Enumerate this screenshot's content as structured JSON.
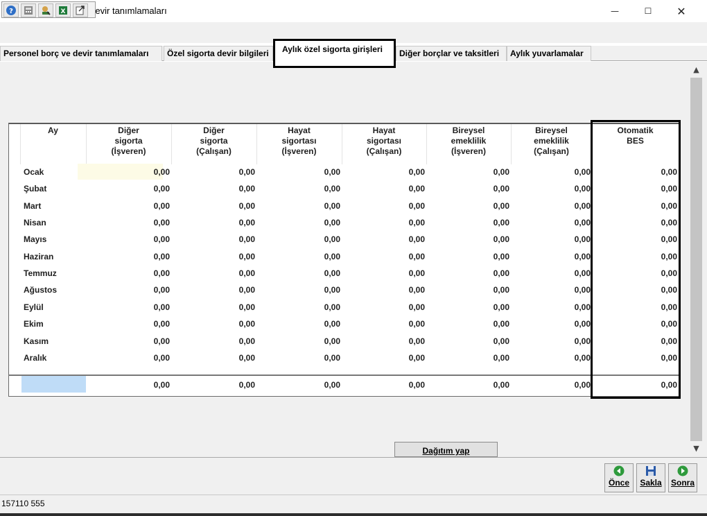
{
  "window": {
    "title": "Personel borç ve devir tanımlamaları",
    "controls": {
      "minimize": "—",
      "maximize": "☐",
      "close": "✕"
    }
  },
  "toolbar": {
    "icons": [
      "help-icon",
      "calculator-icon",
      "search-user-icon",
      "excel-icon",
      "export-icon"
    ]
  },
  "tabs": [
    {
      "label": "Personel borç ve devir tanımlamaları"
    },
    {
      "label": "Özel sigorta devir bilgileri"
    },
    {
      "label": "Aylık özel sigorta girişleri",
      "active": true
    },
    {
      "label": "Diğer borçlar ve taksitleri"
    },
    {
      "label": "Aylık yuvarlamalar"
    }
  ],
  "grid": {
    "headers": [
      "Ay",
      "Diğer\nsigorta\n(İşveren)",
      "Diğer\nsigorta\n(Çalışan)",
      "Hayat\nsigortası\n(İşveren)",
      "Hayat\nsigortası\n(Çalışan)",
      "Bireysel\nemeklilik\n(İşveren)",
      "Bireysel\nemeklilik\n(Çalışan)",
      "Otomatik\nBES"
    ],
    "rows": [
      {
        "month": "Ocak",
        "values": [
          "0,00",
          "0,00",
          "0,00",
          "0,00",
          "0,00",
          "0,00",
          "0,00"
        ]
      },
      {
        "month": "Şubat",
        "values": [
          "0,00",
          "0,00",
          "0,00",
          "0,00",
          "0,00",
          "0,00",
          "0,00"
        ]
      },
      {
        "month": "Mart",
        "values": [
          "0,00",
          "0,00",
          "0,00",
          "0,00",
          "0,00",
          "0,00",
          "0,00"
        ]
      },
      {
        "month": "Nisan",
        "values": [
          "0,00",
          "0,00",
          "0,00",
          "0,00",
          "0,00",
          "0,00",
          "0,00"
        ]
      },
      {
        "month": "Mayıs",
        "values": [
          "0,00",
          "0,00",
          "0,00",
          "0,00",
          "0,00",
          "0,00",
          "0,00"
        ]
      },
      {
        "month": "Haziran",
        "values": [
          "0,00",
          "0,00",
          "0,00",
          "0,00",
          "0,00",
          "0,00",
          "0,00"
        ]
      },
      {
        "month": "Temmuz",
        "values": [
          "0,00",
          "0,00",
          "0,00",
          "0,00",
          "0,00",
          "0,00",
          "0,00"
        ]
      },
      {
        "month": "Ağustos",
        "values": [
          "0,00",
          "0,00",
          "0,00",
          "0,00",
          "0,00",
          "0,00",
          "0,00"
        ]
      },
      {
        "month": "Eylül",
        "values": [
          "0,00",
          "0,00",
          "0,00",
          "0,00",
          "0,00",
          "0,00",
          "0,00"
        ]
      },
      {
        "month": "Ekim",
        "values": [
          "0,00",
          "0,00",
          "0,00",
          "0,00",
          "0,00",
          "0,00",
          "0,00"
        ]
      },
      {
        "month": "Kasım",
        "values": [
          "0,00",
          "0,00",
          "0,00",
          "0,00",
          "0,00",
          "0,00",
          "0,00"
        ]
      },
      {
        "month": "Aralık",
        "values": [
          "0,00",
          "0,00",
          "0,00",
          "0,00",
          "0,00",
          "0,00",
          "0,00"
        ]
      }
    ],
    "totals": [
      "0,00",
      "0,00",
      "0,00",
      "0,00",
      "0,00",
      "0,00",
      "0,00"
    ]
  },
  "actions": {
    "distribute": "Dağıtım yap",
    "previous": "Önce",
    "save": "Sakla",
    "next": "Sonra"
  },
  "status": {
    "text": "157110 555"
  },
  "colors": {
    "highlight_cell": "#fdfbe6",
    "total_selection": "#bfdcf7",
    "nav_green": "#2e9a3c",
    "save_blue": "#2a5aa8"
  }
}
